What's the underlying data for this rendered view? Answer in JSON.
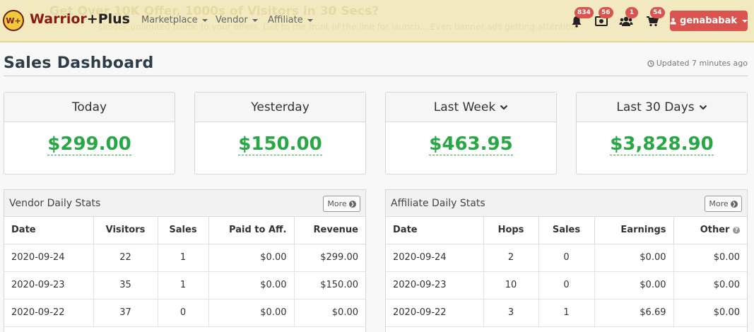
{
  "navbar": {
    "ghost_headline": "Get Over 10K Offer, 1000s of Visitors in 30 Secs?",
    "ghost_sub": "Unlock unlimited traffic to your offers. Get to the front of the line for launch... Even banner ads getting attention",
    "logo_mark": "W+",
    "brand_part1": "Warrior",
    "brand_part2": "+Plus",
    "menus": [
      {
        "label": "Marketplace"
      },
      {
        "label": "Vendor"
      },
      {
        "label": "Affiliate"
      }
    ],
    "icons": [
      {
        "name": "bell-icon",
        "badge": "834"
      },
      {
        "name": "money-icon",
        "badge": "56"
      },
      {
        "name": "users-icon",
        "badge": "1"
      },
      {
        "name": "cart-icon",
        "badge": "54"
      }
    ],
    "user_label": "genababak",
    "colors": {
      "bar": "#f2e9c0",
      "badge": "#d9534f",
      "user_button": "#d9534f"
    }
  },
  "header": {
    "title": "Sales Dashboard",
    "updated": "Updated 7 minutes ago"
  },
  "stats": [
    {
      "label": "Today",
      "value": "$299.00",
      "dropdown": false
    },
    {
      "label": "Yesterday",
      "value": "$150.00",
      "dropdown": false
    },
    {
      "label": "Last Week",
      "value": "$463.95",
      "dropdown": true
    },
    {
      "label": "Last 30 Days",
      "value": "$3,828.90",
      "dropdown": true
    }
  ],
  "vendor": {
    "title": "Vendor Daily Stats",
    "more": "More",
    "columns": [
      "Date",
      "Visitors",
      "Sales",
      "Paid to Aff.",
      "Revenue"
    ],
    "rows": [
      [
        "2020-09-24",
        "22",
        "1",
        "$0.00",
        "$299.00"
      ],
      [
        "2020-09-23",
        "35",
        "1",
        "$0.00",
        "$150.00"
      ],
      [
        "2020-09-22",
        "37",
        "0",
        "$0.00",
        "$0.00"
      ]
    ]
  },
  "affiliate": {
    "title": "Affiliate Daily Stats",
    "more": "More",
    "columns": [
      "Date",
      "Hops",
      "Sales",
      "Earnings",
      "Other"
    ],
    "rows": [
      [
        "2020-09-24",
        "2",
        "0",
        "$0.00",
        "$0.00"
      ],
      [
        "2020-09-23",
        "10",
        "0",
        "$0.00",
        "$0.00"
      ],
      [
        "2020-09-22",
        "3",
        "1",
        "$6.69",
        "$0.00"
      ]
    ]
  }
}
